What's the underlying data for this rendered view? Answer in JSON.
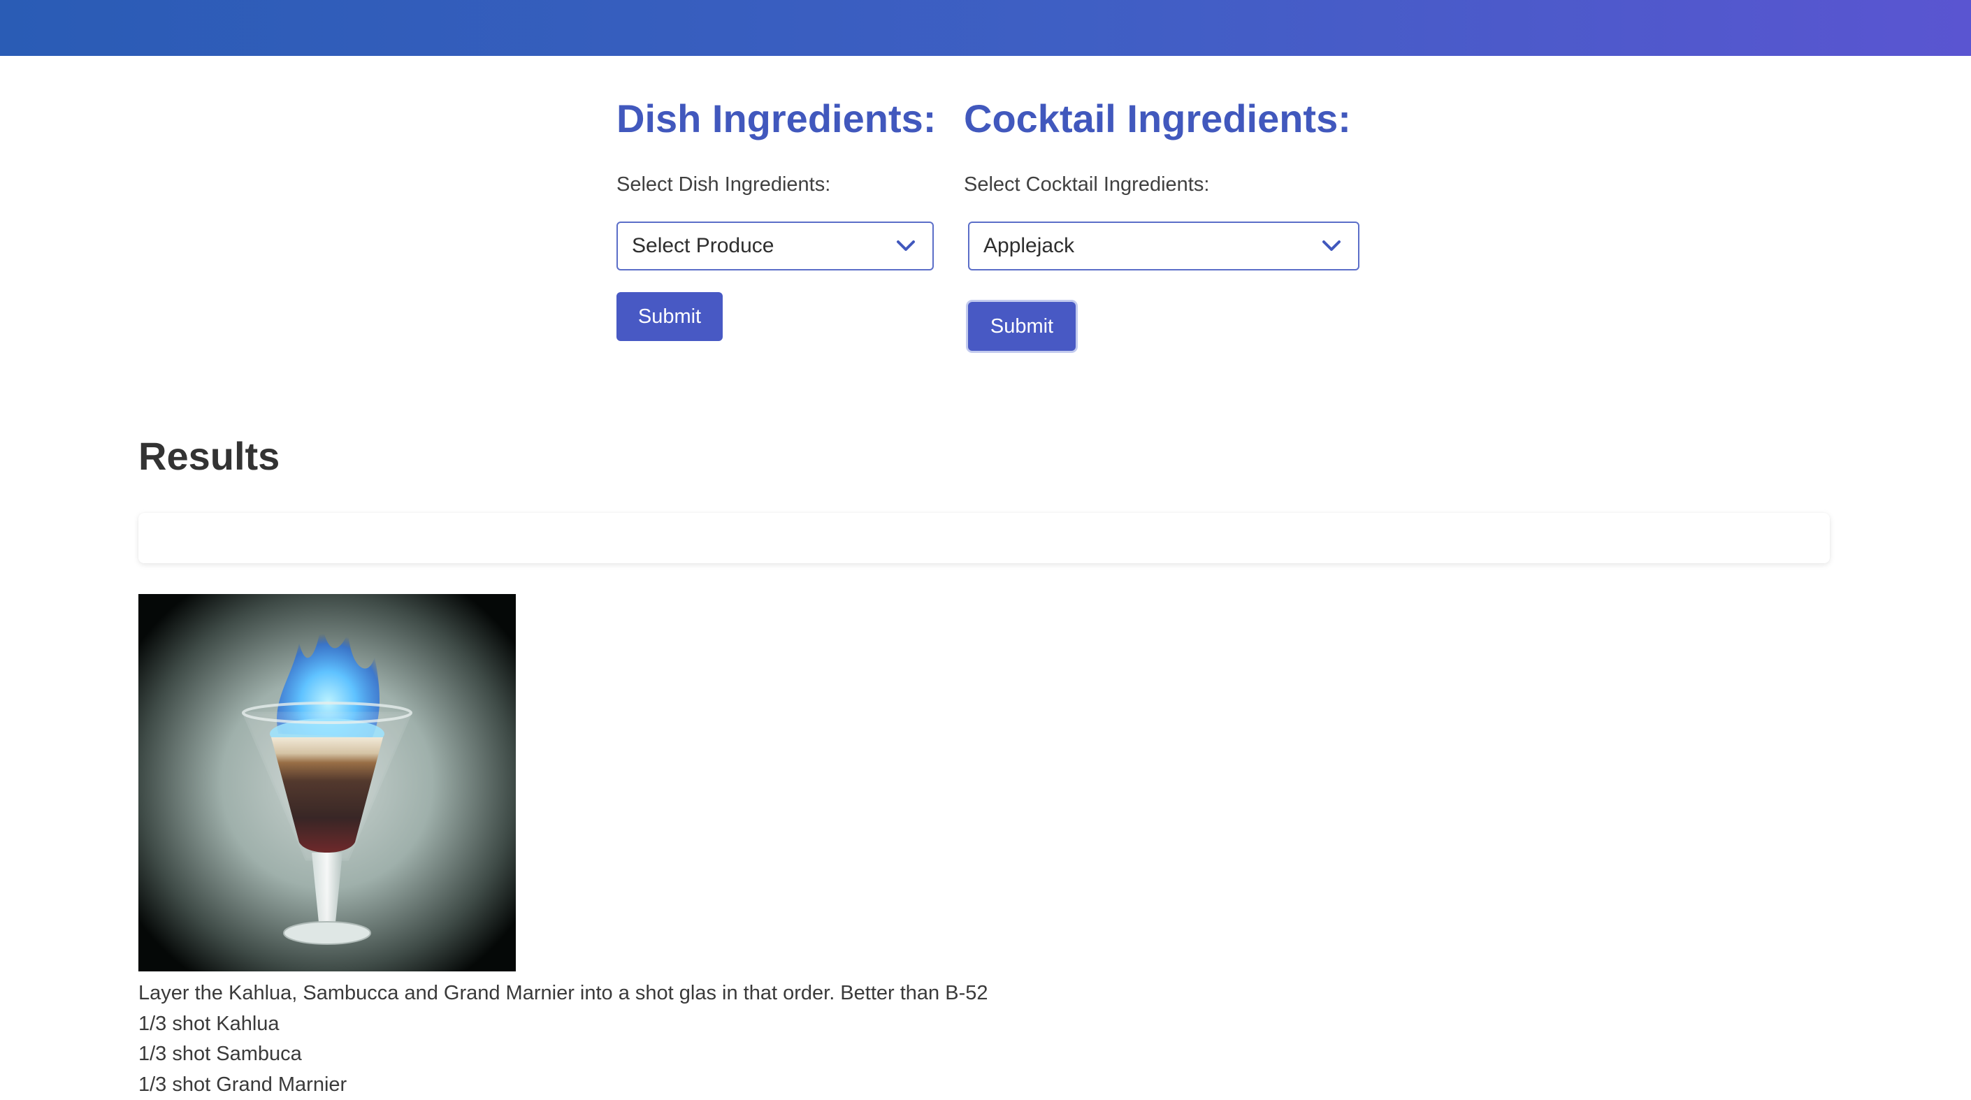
{
  "dish": {
    "heading": "Dish Ingredients:",
    "label": "Select Dish Ingredients:",
    "selected": "Select Produce",
    "submit_label": "Submit"
  },
  "cocktail": {
    "heading": "Cocktail Ingredients:",
    "label": "Select Cocktail Ingredients:",
    "selected": "Applejack",
    "submit_label": "Submit"
  },
  "results": {
    "title": "Results",
    "recipe": {
      "description": "Layer the Kahlua, Sambucca and Grand Marnier into a shot glas in that order. Better than B-52",
      "ingredients": [
        "1/3 shot Kahlua",
        "1/3 shot Sambuca",
        "1/3 shot Grand Marnier"
      ]
    }
  },
  "colors": {
    "accent": "#4158bd",
    "button": "#4859c4",
    "header_gradient_start": "#2a5cb5",
    "header_gradient_end": "#5a55d1"
  },
  "icons": {
    "dropdown": "chevron-down-icon"
  }
}
